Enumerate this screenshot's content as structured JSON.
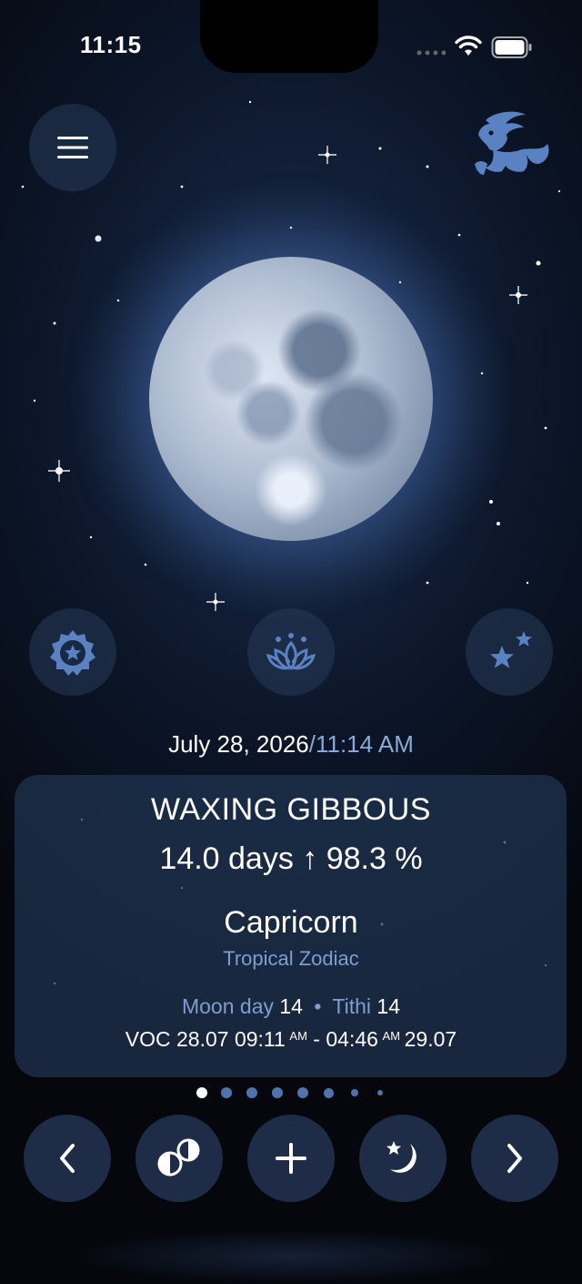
{
  "status_bar": {
    "time": "11:15"
  },
  "header": {
    "menu_icon": "hamburger-menu-icon",
    "zodiac_icon": "capricorn-sign-icon"
  },
  "moon": {
    "illumination_percent": 98.3
  },
  "feature_buttons": [
    {
      "name": "badge-star-icon"
    },
    {
      "name": "lotus-icon"
    },
    {
      "name": "stars-icon"
    }
  ],
  "datetime": {
    "date": "July 28, 2026",
    "separator": "/",
    "time": "11:14 AM"
  },
  "card": {
    "phase": "WAXING GIBBOUS",
    "stats": "14.0 days ↑ 98.3 %",
    "sign": "Capricorn",
    "zodiac_type": "Tropical Zodiac",
    "moon_day_label": "Moon day",
    "moon_day_value": "14",
    "tithi_label": "Tithi",
    "tithi_value": "14",
    "voc": {
      "prefix": "VOC 28.07 09:11",
      "start_ampm": "AM",
      "middle": " - 04:46",
      "end_ampm": "AM",
      "suffix": "29.07"
    }
  },
  "pager": {
    "count": 8,
    "active_index": 0
  },
  "bottom_nav": [
    {
      "name": "previous-day-button",
      "icon": "chevron-left-icon"
    },
    {
      "name": "moon-phases-button",
      "icon": "moon-phases-icon"
    },
    {
      "name": "add-button",
      "icon": "plus-icon"
    },
    {
      "name": "night-mode-button",
      "icon": "moon-star-icon"
    },
    {
      "name": "next-day-button",
      "icon": "chevron-right-icon"
    }
  ],
  "colors": {
    "accent": "#5a82c2",
    "accent_text": "#7f9ed0",
    "card_bg": "#203452"
  }
}
